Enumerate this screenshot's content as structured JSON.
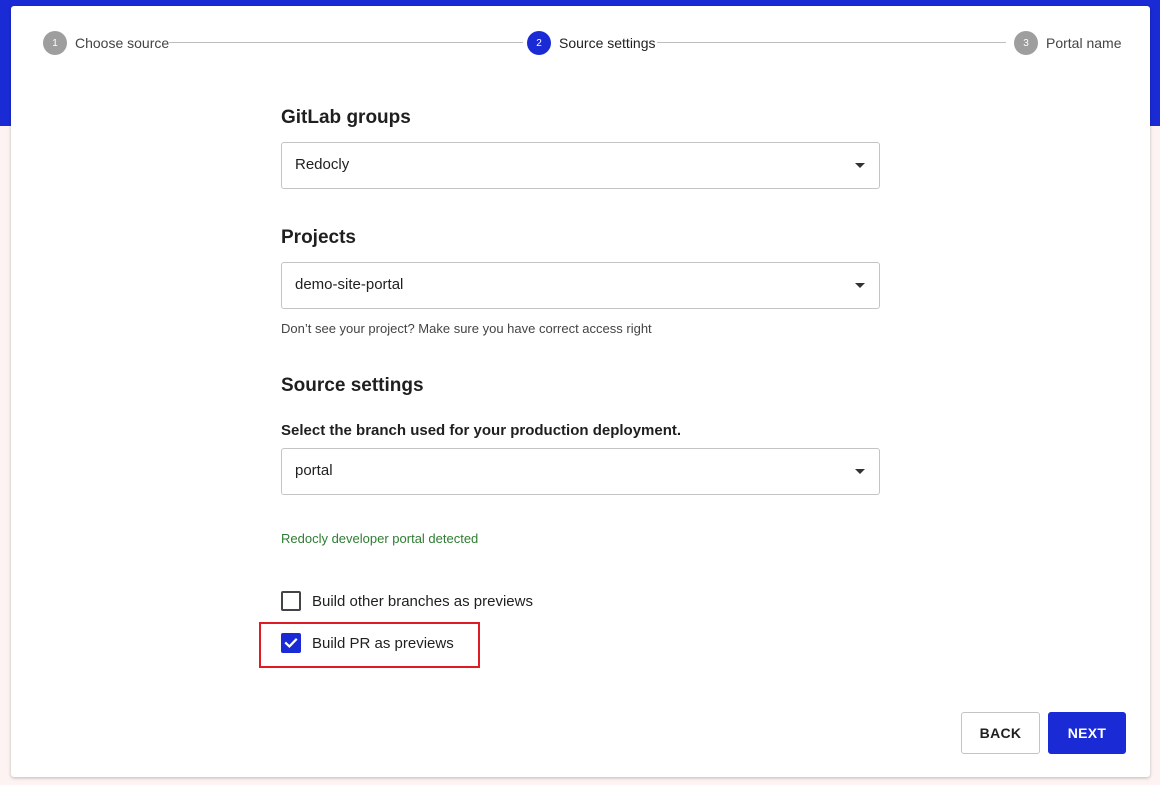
{
  "stepper": {
    "steps": [
      {
        "number": "1",
        "label": "Choose source"
      },
      {
        "number": "2",
        "label": "Source settings"
      },
      {
        "number": "3",
        "label": "Portal name"
      }
    ]
  },
  "gitlab_groups": {
    "title": "GitLab groups",
    "selected": "Redocly"
  },
  "projects": {
    "title": "Projects",
    "selected": "demo-site-portal",
    "helper": "Don’t see your project? Make sure you have correct access right"
  },
  "source_settings": {
    "title": "Source settings",
    "branch_label": "Select the branch used for your production deployment.",
    "branch_selected": "portal",
    "detected": "Redocly developer portal detected",
    "options": [
      {
        "label": "Build other branches as previews",
        "checked": false
      },
      {
        "label": "Build PR as previews",
        "checked": true
      }
    ]
  },
  "actions": {
    "back_label": "BACK",
    "next_label": "NEXT"
  },
  "colors": {
    "primary": "#1a2bd6",
    "success": "#2e7d32",
    "highlight": "#e01b24"
  }
}
